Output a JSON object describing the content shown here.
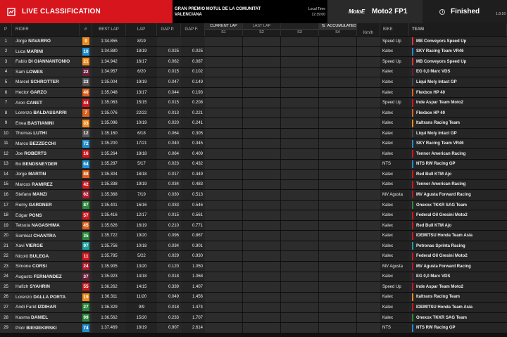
{
  "header": {
    "title": "LIVE CLASSIFICATION",
    "event_line1": "GRAN PREMIO MOTUL DE LA COMUNITAT",
    "event_line2": "VALENCIANA",
    "local_time_label": "Local Time",
    "local_time": "12:39:00",
    "series_logo": "MotoE",
    "class": "Moto2 FP1",
    "status": "Finished",
    "version": "1.8.16"
  },
  "columns": {
    "p": "P",
    "rider": "RIDER",
    "num": "#",
    "best_lap": "BEST LAP",
    "lap": "LAP",
    "gap_p": "GAP P.",
    "gap_f": "GAP F.",
    "tab_current": "CURRENT LAP",
    "tab_last": "LAST LAP",
    "tab_accum": "ACCUMULATED",
    "s1": "S1",
    "s2": "S2",
    "s3": "S3",
    "s4": "S4",
    "kmh": "Km/h",
    "bike": "BIKE",
    "team": "TEAM"
  },
  "colors": {
    "accent_red": "#d7151d"
  },
  "rows": [
    {
      "p": "1",
      "first": "Jorge",
      "last": "NAVARRO",
      "num": "9",
      "num_color": "#f28a1a",
      "best": "1:34.855",
      "lap": "8/19",
      "gap_p": "",
      "gap_f": "",
      "bike": "Speed Up",
      "team": "MB Conveyors Speed Up",
      "team_color": "#e8322d"
    },
    {
      "p": "2",
      "first": "Luca",
      "last": "MARINI",
      "num": "10",
      "num_color": "#1f8fd0",
      "best": "1:34.880",
      "lap": "18/19",
      "gap_p": "0.025",
      "gap_f": "0.025",
      "bike": "Kalex",
      "team": "SKY Racing Team VR46",
      "team_color": "#1f8fd0"
    },
    {
      "p": "3",
      "first": "Fabio",
      "last": "DI GIANNANTONIO",
      "num": "21",
      "num_color": "#f28a1a",
      "best": "1:34.942",
      "lap": "16/17",
      "gap_p": "0.062",
      "gap_f": "0.087",
      "bike": "Speed Up",
      "team": "MB Conveyors Speed Up",
      "team_color": "#e8322d"
    },
    {
      "p": "4",
      "first": "Sam",
      "last": "LOWES",
      "num": "22",
      "num_color": "#6b1f3a",
      "best": "1:34.957",
      "lap": "6/20",
      "gap_p": "0.015",
      "gap_f": "0.102",
      "bike": "Kalex",
      "team": "EG 0,0 Marc VDS",
      "team_color": "#6b1f3a"
    },
    {
      "p": "5",
      "first": "Marcel",
      "last": "SCHROTTER",
      "num": "23",
      "num_color": "#555555",
      "best": "1:35.004",
      "lap": "19/19",
      "gap_p": "0.047",
      "gap_f": "0.149",
      "bike": "Kalex",
      "team": "Liqui Moly Intact GP",
      "team_color": "#444444"
    },
    {
      "p": "6",
      "first": "Hector",
      "last": "GARZO",
      "num": "40",
      "num_color": "#e0601a",
      "best": "1:35.048",
      "lap": "13/17",
      "gap_p": "0.044",
      "gap_f": "0.193",
      "bike": "Kalex",
      "team": "Flexbox HP 40",
      "team_color": "#e0601a"
    },
    {
      "p": "7",
      "first": "Aron",
      "last": "CANET",
      "num": "44",
      "num_color": "#d7151d",
      "best": "1:35.063",
      "lap": "15/15",
      "gap_p": "0.015",
      "gap_f": "0.208",
      "bike": "Speed Up",
      "team": "Inde Aspar Team Moto2",
      "team_color": "#d7151d"
    },
    {
      "p": "8",
      "first": "Lorenzo",
      "last": "BALDASSARRI",
      "num": "7",
      "num_color": "#e0601a",
      "best": "1:35.076",
      "lap": "22/22",
      "gap_p": "0.013",
      "gap_f": "0.221",
      "bike": "Kalex",
      "team": "Flexbox HP 40",
      "team_color": "#e0601a"
    },
    {
      "p": "9",
      "first": "Enea",
      "last": "BASTIANINI",
      "num": "33",
      "num_color": "#f28a1a",
      "best": "1:35.096",
      "lap": "10/19",
      "gap_p": "0.020",
      "gap_f": "0.241",
      "bike": "Kalex",
      "team": "Italtrans Racing Team",
      "team_color": "#f28a1a"
    },
    {
      "p": "10",
      "first": "Thomas",
      "last": "LUTHI",
      "num": "12",
      "num_color": "#555555",
      "best": "1:35.160",
      "lap": "6/18",
      "gap_p": "0.064",
      "gap_f": "0.305",
      "bike": "Kalex",
      "team": "Liqui Moly Intact GP",
      "team_color": "#444444"
    },
    {
      "p": "11",
      "first": "Marco",
      "last": "BEZZECCHI",
      "num": "72",
      "num_color": "#1f8fd0",
      "best": "1:35.200",
      "lap": "17/21",
      "gap_p": "0.040",
      "gap_f": "0.345",
      "bike": "Kalex",
      "team": "SKY Racing Team VR46",
      "team_color": "#1f8fd0"
    },
    {
      "p": "12",
      "first": "Joe",
      "last": "ROBERTS",
      "num": "16",
      "num_color": "#d7151d",
      "best": "1:35.264",
      "lap": "18/18",
      "gap_p": "0.064",
      "gap_f": "0.409",
      "bike": "Kalex",
      "team": "Tennor American Racing",
      "team_color": "#d7151d"
    },
    {
      "p": "13",
      "first": "Bo",
      "last": "BENDSNEYDER",
      "num": "64",
      "num_color": "#1f8fd0",
      "best": "1:35.287",
      "lap": "5/17",
      "gap_p": "0.023",
      "gap_f": "0.432",
      "bike": "NTS",
      "team": "NTS RW Racing GP",
      "team_color": "#1f8fd0"
    },
    {
      "p": "14",
      "first": "Jorge",
      "last": "MARTIN",
      "num": "88",
      "num_color": "#e0601a",
      "best": "1:35.304",
      "lap": "18/18",
      "gap_p": "0.017",
      "gap_f": "0.449",
      "bike": "Kalex",
      "team": "Red Bull KTM Ajo",
      "team_color": "#d7151d"
    },
    {
      "p": "15",
      "first": "Marcos",
      "last": "RAMIREZ",
      "num": "42",
      "num_color": "#d7151d",
      "best": "1:35.338",
      "lap": "19/19",
      "gap_p": "0.034",
      "gap_f": "0.483",
      "bike": "Kalex",
      "team": "Tennor American Racing",
      "team_color": "#d7151d"
    },
    {
      "p": "16",
      "first": "Stefano",
      "last": "MANZI",
      "num": "62",
      "num_color": "#b3182a",
      "best": "1:35.368",
      "lap": "7/19",
      "gap_p": "0.030",
      "gap_f": "0.513",
      "bike": "MV Agusta",
      "team": "MV Agusta Forward Racing",
      "team_color": "#b3182a"
    },
    {
      "p": "17",
      "first": "Remy",
      "last": "GARDNER",
      "num": "87",
      "num_color": "#2a8a3a",
      "best": "1:35.401",
      "lap": "16/16",
      "gap_p": "0.033",
      "gap_f": "0.546",
      "bike": "Kalex",
      "team": "Onexox TKKR SAG Team",
      "team_color": "#2a8a3a"
    },
    {
      "p": "18",
      "first": "Edgar",
      "last": "PONS",
      "num": "57",
      "num_color": "#d7151d",
      "best": "1:35.416",
      "lap": "12/17",
      "gap_p": "0.015",
      "gap_f": "0.561",
      "bike": "Kalex",
      "team": "Federal Oil Gresini Moto2",
      "team_color": "#d7151d"
    },
    {
      "p": "19",
      "first": "Tetsuta",
      "last": "NAGASHIMA",
      "num": "45",
      "num_color": "#e0601a",
      "best": "1:35.626",
      "lap": "16/19",
      "gap_p": "0.210",
      "gap_f": "0.771",
      "bike": "Kalex",
      "team": "Red Bull KTM Ajo",
      "team_color": "#d7151d"
    },
    {
      "p": "20",
      "first": "Somkiat",
      "last": "CHANTRA",
      "num": "35",
      "num_color": "#2a8a3a",
      "best": "1:35.722",
      "lap": "19/20",
      "gap_p": "0.096",
      "gap_f": "0.867",
      "bike": "Kalex",
      "team": "IDEMITSU Honda Team Asia",
      "team_color": "#d7151d"
    },
    {
      "p": "21",
      "first": "Xavi",
      "last": "VIERGE",
      "num": "97",
      "num_color": "#1aa0a0",
      "best": "1:35.756",
      "lap": "10/18",
      "gap_p": "0.034",
      "gap_f": "0.901",
      "bike": "Kalex",
      "team": "Petronas Sprinta Racing",
      "team_color": "#1aa0a0"
    },
    {
      "p": "22",
      "first": "Nicolò",
      "last": "BULEGA",
      "num": "11",
      "num_color": "#d7151d",
      "best": "1:35.785",
      "lap": "5/22",
      "gap_p": "0.029",
      "gap_f": "0.930",
      "bike": "Kalex",
      "team": "Federal Oil Gresini Moto2",
      "team_color": "#d7151d"
    },
    {
      "p": "23",
      "first": "Simone",
      "last": "CORSI",
      "num": "24",
      "num_color": "#b3182a",
      "best": "1:35.905",
      "lap": "13/20",
      "gap_p": "0.120",
      "gap_f": "1.050",
      "bike": "MV Agusta",
      "team": "MV Agusta Forward Racing",
      "team_color": "#b3182a"
    },
    {
      "p": "24",
      "first": "Augusto",
      "last": "FERNANDEZ",
      "num": "37",
      "num_color": "#6b1f3a",
      "best": "1:35.923",
      "lap": "14/18",
      "gap_p": "0.018",
      "gap_f": "1.068",
      "bike": "Kalex",
      "team": "EG 0,0 Marc VDS",
      "team_color": "#6b1f3a"
    },
    {
      "p": "25",
      "first": "Hafizh",
      "last": "SYAHRIN",
      "num": "55",
      "num_color": "#d7151d",
      "best": "1:36.262",
      "lap": "14/15",
      "gap_p": "0.339",
      "gap_f": "1.407",
      "bike": "Speed Up",
      "team": "Inde Aspar Team Moto2",
      "team_color": "#d7151d"
    },
    {
      "p": "26",
      "first": "Lorenzo",
      "last": "DALLA PORTA",
      "num": "19",
      "num_color": "#f28a1a",
      "best": "1:36.311",
      "lap": "11/20",
      "gap_p": "0.049",
      "gap_f": "1.456",
      "bike": "Kalex",
      "team": "Italtrans Racing Team",
      "team_color": "#f28a1a"
    },
    {
      "p": "27",
      "first": "Andi Farid",
      "last": "IZDIHAR",
      "num": "27",
      "num_color": "#2a8a3a",
      "best": "1:36.329",
      "lap": "9/9",
      "gap_p": "0.018",
      "gap_f": "1.474",
      "bike": "Kalex",
      "team": "IDEMITSU Honda Team Asia",
      "team_color": "#d7151d"
    },
    {
      "p": "28",
      "first": "Kasma",
      "last": "DANIEL",
      "num": "99",
      "num_color": "#2a8a3a",
      "best": "1:36.562",
      "lap": "15/20",
      "gap_p": "0.233",
      "gap_f": "1.707",
      "bike": "Kalex",
      "team": "Onexox TKKR SAG Team",
      "team_color": "#2a8a3a"
    },
    {
      "p": "29",
      "first": "Piotr",
      "last": "BIESIEKIRSKI",
      "num": "74",
      "num_color": "#1f8fd0",
      "best": "1:37.469",
      "lap": "18/19",
      "gap_p": "0.907",
      "gap_f": "2.614",
      "bike": "NTS",
      "team": "NTS RW Racing GP",
      "team_color": "#1f8fd0"
    }
  ]
}
